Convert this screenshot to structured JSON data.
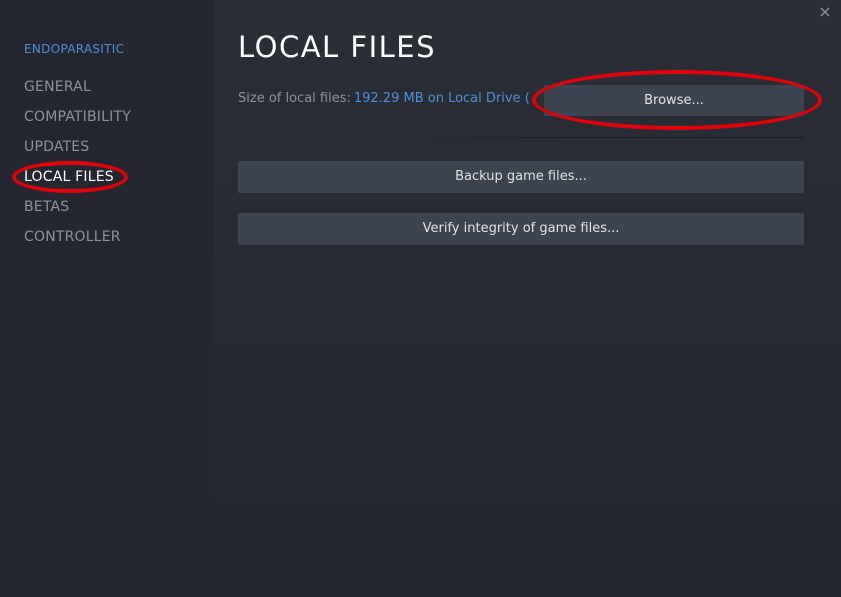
{
  "sidebar": {
    "game_title": "ENDOPARASITIC",
    "items": [
      {
        "label": "GENERAL"
      },
      {
        "label": "COMPATIBILITY"
      },
      {
        "label": "UPDATES"
      },
      {
        "label": "LOCAL FILES"
      },
      {
        "label": "BETAS"
      },
      {
        "label": "CONTROLLER"
      }
    ],
    "active_index": 3
  },
  "header": {
    "close_glyph": "×"
  },
  "main": {
    "title": "LOCAL FILES",
    "size_label": "Size of local files:",
    "size_value": "192.29 MB on Local Drive (",
    "browse_label": "Browse...",
    "backup_label": "Backup game files...",
    "verify_label": "Verify integrity of game files..."
  },
  "icons": {
    "close": "close-icon"
  },
  "colors": {
    "accent_blue": "#4f8ed8",
    "annotation_red": "#e3000b",
    "button_bg": "#3d4450",
    "sidebar_bg": "#24272f",
    "main_bg": "#2a2e37"
  }
}
